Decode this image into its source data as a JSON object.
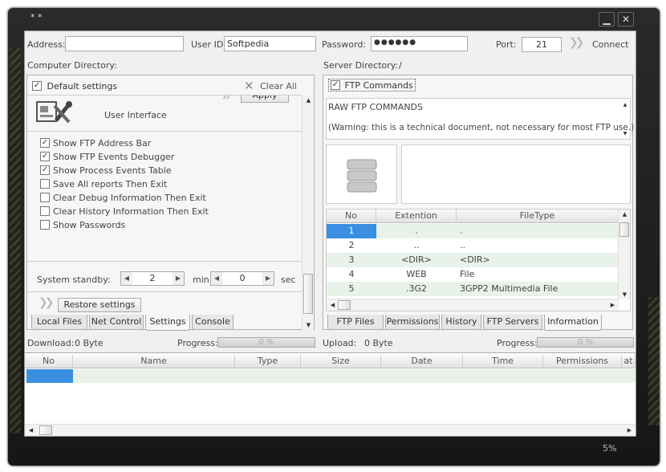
{
  "window": {
    "title": "* *",
    "minimize_label": "▁",
    "close_label": "✕",
    "status_percent": "5%"
  },
  "connection": {
    "address_label": "Address:",
    "address_value": "",
    "user_label": "User ID:",
    "user_value": "Softpedia",
    "password_label": "Password:",
    "password_value": "●●●●●●",
    "port_label": "Port:",
    "port_value": "21",
    "connect_label": "Connect"
  },
  "left": {
    "header": "Computer Directory:",
    "default_settings_label": "Default settings",
    "clear_all_label": "Clear All",
    "apply_label": "Apply",
    "section_title": "User Interface",
    "options": [
      {
        "label": "Show FTP Address Bar",
        "checked": true
      },
      {
        "label": "Show FTP Events Debugger",
        "checked": true
      },
      {
        "label": "Show Process Events Table",
        "checked": true
      },
      {
        "label": "Save All reports Then Exit",
        "checked": false
      },
      {
        "label": "Clear Debug Information Then Exit",
        "checked": false
      },
      {
        "label": "Clear History Information Then Exit",
        "checked": false
      },
      {
        "label": "Show Passwords",
        "checked": false
      }
    ],
    "standby_label": "System standby:",
    "standby_min": "2",
    "min_label": "min",
    "standby_sec": "0",
    "sec_label": "sec",
    "restore_label": "Restore settings",
    "tabs": [
      "Local Files",
      "Net Control",
      "Settings",
      "Console"
    ],
    "active_tab": "Settings",
    "download_label": "Download:",
    "download_value": "0 Byte",
    "progress_label": "Progress:",
    "progress_text": "0 %"
  },
  "right": {
    "header": "Server Directory:",
    "path": "/",
    "ftp_commands_label": "FTP Commands",
    "raw_title": "RAW FTP COMMANDS",
    "raw_warning": "(Warning: this is a technical document, not necessary for most FTP use.)",
    "columns": [
      "No",
      "Extention",
      "FileType"
    ],
    "rows": [
      {
        "no": "1",
        "ext": ".",
        "type": "."
      },
      {
        "no": "2",
        "ext": "..",
        "type": ".."
      },
      {
        "no": "3",
        "ext": "<DIR>",
        "type": "<DIR>"
      },
      {
        "no": "4",
        "ext": "WEB",
        "type": "File"
      },
      {
        "no": "5",
        "ext": ".3G2",
        "type": "3GPP2 Multimedia File"
      }
    ],
    "tabs": [
      "FTP Files",
      "Permissions",
      "History",
      "FTP Servers",
      "Information"
    ],
    "active_tab": "Information",
    "upload_label": "Upload:",
    "upload_value": "0 Byte",
    "progress_label": "Progress:",
    "progress_text": "0 %"
  },
  "transfer": {
    "columns": [
      "No",
      "Name",
      "Type",
      "Size",
      "Date",
      "Time",
      "Permissions",
      "at"
    ]
  }
}
